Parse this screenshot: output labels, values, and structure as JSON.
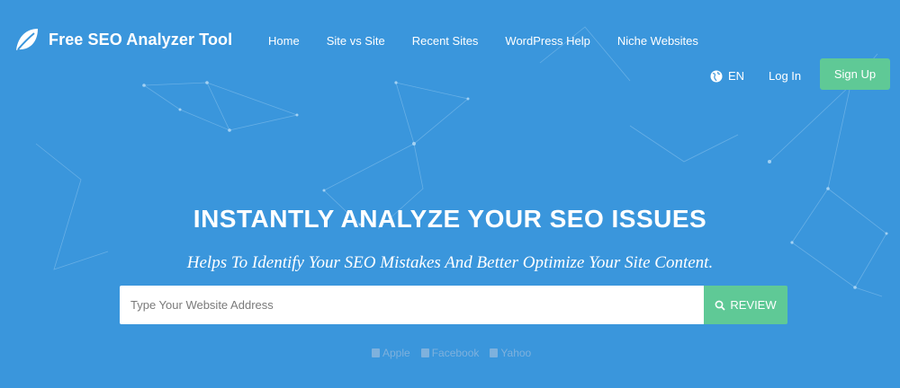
{
  "brand": {
    "name": "Free SEO Analyzer Tool"
  },
  "nav": {
    "items": [
      "Home",
      "Site vs Site",
      "Recent Sites",
      "WordPress Help",
      "Niche Websites"
    ]
  },
  "header": {
    "lang": "EN",
    "login": "Log In",
    "signup": "Sign Up"
  },
  "hero": {
    "title": "INSTANTLY ANALYZE YOUR SEO ISSUES",
    "subtitle": "Helps To Identify Your SEO Mistakes And Better Optimize Your Site Content."
  },
  "search": {
    "placeholder": "Type Your Website Address",
    "button": "REVIEW"
  },
  "social": [
    "Apple",
    "Facebook",
    "Yahoo"
  ],
  "colors": {
    "background": "#3a96dc",
    "accent": "#5fc996"
  },
  "icons": {
    "logo": "leaf-icon",
    "lang": "globe-icon",
    "review": "search-icon"
  }
}
